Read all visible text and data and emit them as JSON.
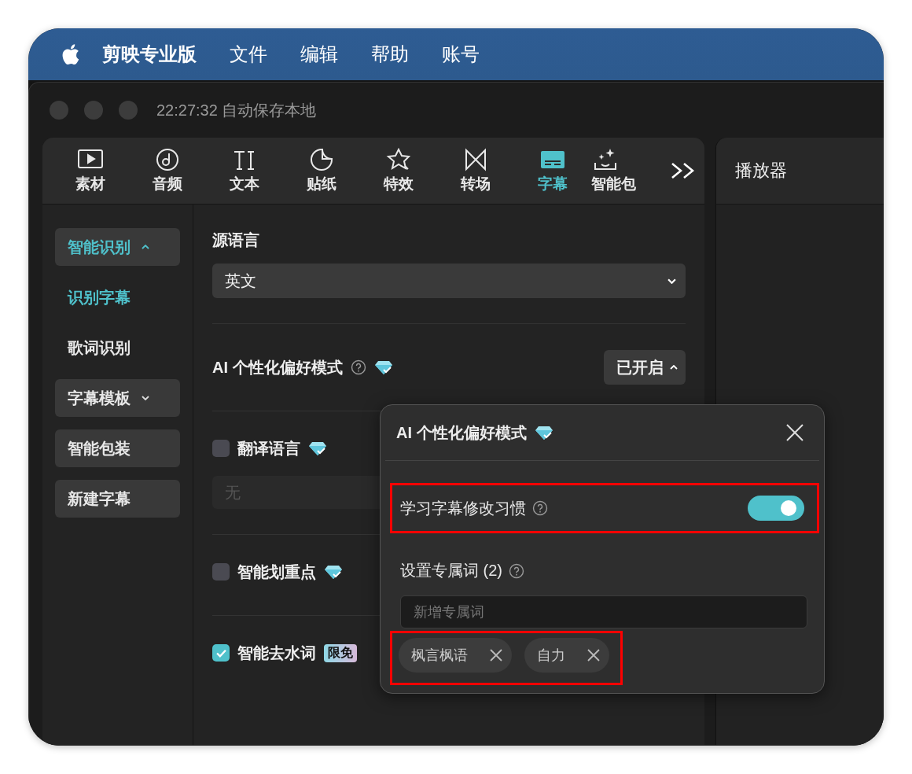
{
  "menubar": {
    "app_name": "剪映专业版",
    "menus": [
      "文件",
      "编辑",
      "帮助",
      "账号"
    ]
  },
  "window": {
    "title": "22:27:32 自动保存本地"
  },
  "tabs": [
    {
      "label": "素材",
      "selected": false
    },
    {
      "label": "音频",
      "selected": false
    },
    {
      "label": "文本",
      "selected": false
    },
    {
      "label": "贴纸",
      "selected": false
    },
    {
      "label": "特效",
      "selected": false
    },
    {
      "label": "转场",
      "selected": false
    },
    {
      "label": "字幕",
      "selected": true
    },
    {
      "label": "智能包",
      "selected": false
    }
  ],
  "sidebar": {
    "items": [
      {
        "label": "智能识别",
        "kind": "group",
        "expanded": true,
        "children": [
          {
            "label": "识别字幕",
            "selected": true
          },
          {
            "label": "歌词识别",
            "selected": false
          }
        ]
      },
      {
        "label": "字幕模板",
        "kind": "group",
        "expanded": false
      },
      {
        "label": "智能包装",
        "kind": "button"
      },
      {
        "label": "新建字幕",
        "kind": "button"
      }
    ]
  },
  "source_language": {
    "label": "源语言",
    "value": "英文"
  },
  "ai_mode": {
    "label": "AI 个性化偏好模式",
    "status": "已开启",
    "expanded": true
  },
  "options": [
    {
      "label": "翻译语言",
      "checked": false,
      "premium": true,
      "select_placeholder": "无"
    },
    {
      "label": "智能划重点",
      "checked": false,
      "premium": true
    },
    {
      "label": "智能去水词",
      "checked": true,
      "premium": false,
      "badge": "限免"
    }
  ],
  "popover": {
    "title": "AI 个性化偏好模式",
    "learn": {
      "label": "学习字幕修改习惯",
      "on": true,
      "highlighted": true
    },
    "terms": {
      "label": "设置专属词 (2)",
      "placeholder": "新增专属词",
      "highlighted": true,
      "tags": [
        "枫言枫语",
        "自力"
      ]
    }
  },
  "player": {
    "title": "播放器"
  }
}
